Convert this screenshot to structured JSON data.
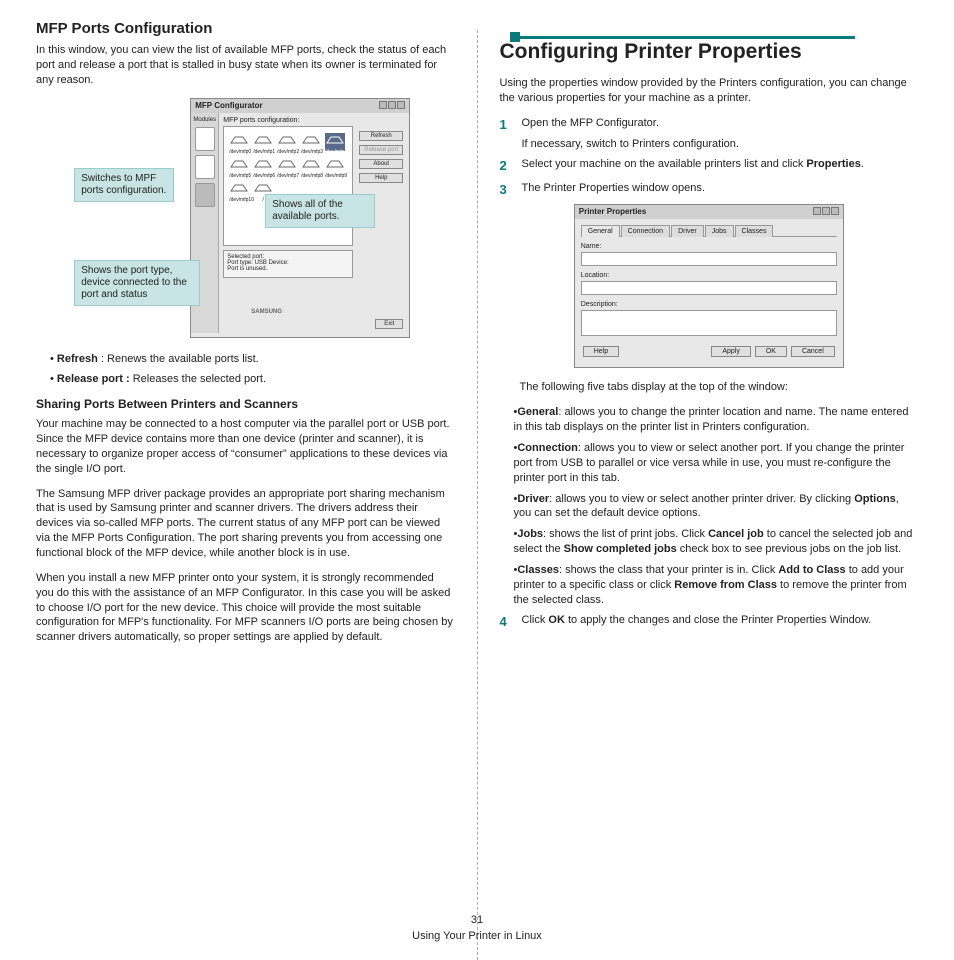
{
  "left": {
    "heading": "MFP Ports Configuration",
    "intro": "In this window, you can view the list of available MFP ports, check the status of each port and release a port that is stalled in busy state when its owner is terminated for any reason.",
    "callouts": {
      "switches": "Switches to MPF ports configuration.",
      "shows_all": "Shows all of the available ports.",
      "shows_port": "Shows the port type, device connected to the port and status"
    },
    "mfp_window": {
      "title": "MFP Configurator",
      "sidebar_label": "Modules",
      "area_label": "MFP ports configuration:",
      "ports": [
        "/dev/mfp0",
        "/dev/mfp1",
        "/dev/mfp2",
        "/dev/mfp3",
        "/dev/mfp4",
        "/dev/mfp5",
        "/dev/mfp6",
        "/dev/mfp7",
        "/dev/mfp8",
        "/dev/mfp9",
        "/dev/mfp10",
        "/"
      ],
      "buttons": {
        "refresh": "Refresh",
        "release": "Release port",
        "about": "About",
        "help": "Help"
      },
      "selected_port_title": "Selected port:",
      "selected_port_info": "Port type: USB   Device:\nPort is unused.",
      "brand": "SAMSUNG",
      "exit": "Exit"
    },
    "bullets": {
      "refresh_label": "Refresh",
      "refresh_text": " : Renews the available ports list.",
      "release_label": "Release port :",
      "release_text": " Releases the selected port."
    },
    "sub_heading": "Sharing Ports Between Printers and Scanners",
    "share_p1": "Your machine may be connected to a host computer via the parallel port or USB port. Since the MFP device contains more than one device (printer and scanner), it is necessary to organize proper access of “consumer” applications to these devices via the single I/O port.",
    "share_p2": "The Samsung MFP driver package provides an appropriate port sharing mechanism that is used by Samsung printer and scanner drivers. The drivers address their devices via so-called MFP ports. The current status of any MFP port can be viewed via the MFP Ports Configuration. The port sharing prevents you from accessing one functional block of the MFP device, while another block is in use.",
    "share_p3": "When you install a new MFP printer onto your system, it is strongly recommended you do this with the assistance of an MFP Configurator. In this case you will be asked to choose I/O port for the new device. This choice will provide the most suitable configuration for MFP's functionality. For MFP scanners I/O ports are being chosen by scanner drivers automatically, so proper settings are applied by default."
  },
  "right": {
    "heading": "Configuring Printer Properties",
    "intro": "Using the properties window provided by the Printers configuration, you can change the various properties for your machine as a printer.",
    "steps": {
      "s1": "Open the MFP Configurator.",
      "s1b": "If necessary, switch to Printers configuration.",
      "s2a": "Select your machine on the available printers list and click ",
      "s2b": "Properties",
      "s2c": ".",
      "s3": "The Printer Properties window opens."
    },
    "pp_window": {
      "title": "Printer Properties",
      "tabs": [
        "General",
        "Connection",
        "Driver",
        "Jobs",
        "Classes"
      ],
      "name": "Name:",
      "location": "Location:",
      "description": "Description:",
      "help": "Help",
      "apply": "Apply",
      "ok": "OK",
      "cancel": "Cancel"
    },
    "tabs_intro": "The following five tabs display at the top of the window:",
    "tab_general_label": "General",
    "tab_general": ": allows you to change the printer location and name. The name entered in this tab displays on the printer list in Printers configuration.",
    "tab_connection_label": "Connection",
    "tab_connection": ": allows you to view or select another port. If you change the printer port from USB to parallel or vice versa while in use, you must re-configure the printer port in this tab.",
    "tab_driver_label": "Driver",
    "tab_driver_a": ": allows you to view or select another printer driver. By clicking ",
    "tab_driver_b": "Options",
    "tab_driver_c": ", you can set the default device options.",
    "tab_jobs_label": "Jobs",
    "tab_jobs_a": ": shows the list of print jobs. Click ",
    "tab_jobs_b": "Cancel job",
    "tab_jobs_c": " to cancel the selected job and select the ",
    "tab_jobs_d": "Show completed jobs",
    "tab_jobs_e": " check box to see previous jobs on the job list.",
    "tab_classes_label": "Classes",
    "tab_classes_a": ": shows the class that your printer is in. Click ",
    "tab_classes_b": "Add to Class",
    "tab_classes_c": " to add your printer to a specific class or click ",
    "tab_classes_d": "Remove from Class",
    "tab_classes_e": " to remove the printer from the selected class.",
    "step4_a": "Click ",
    "step4_b": "OK",
    "step4_c": " to apply the changes and close the Printer Properties Window."
  },
  "footer": {
    "page": "31",
    "chapter": "Using Your Printer in Linux"
  }
}
